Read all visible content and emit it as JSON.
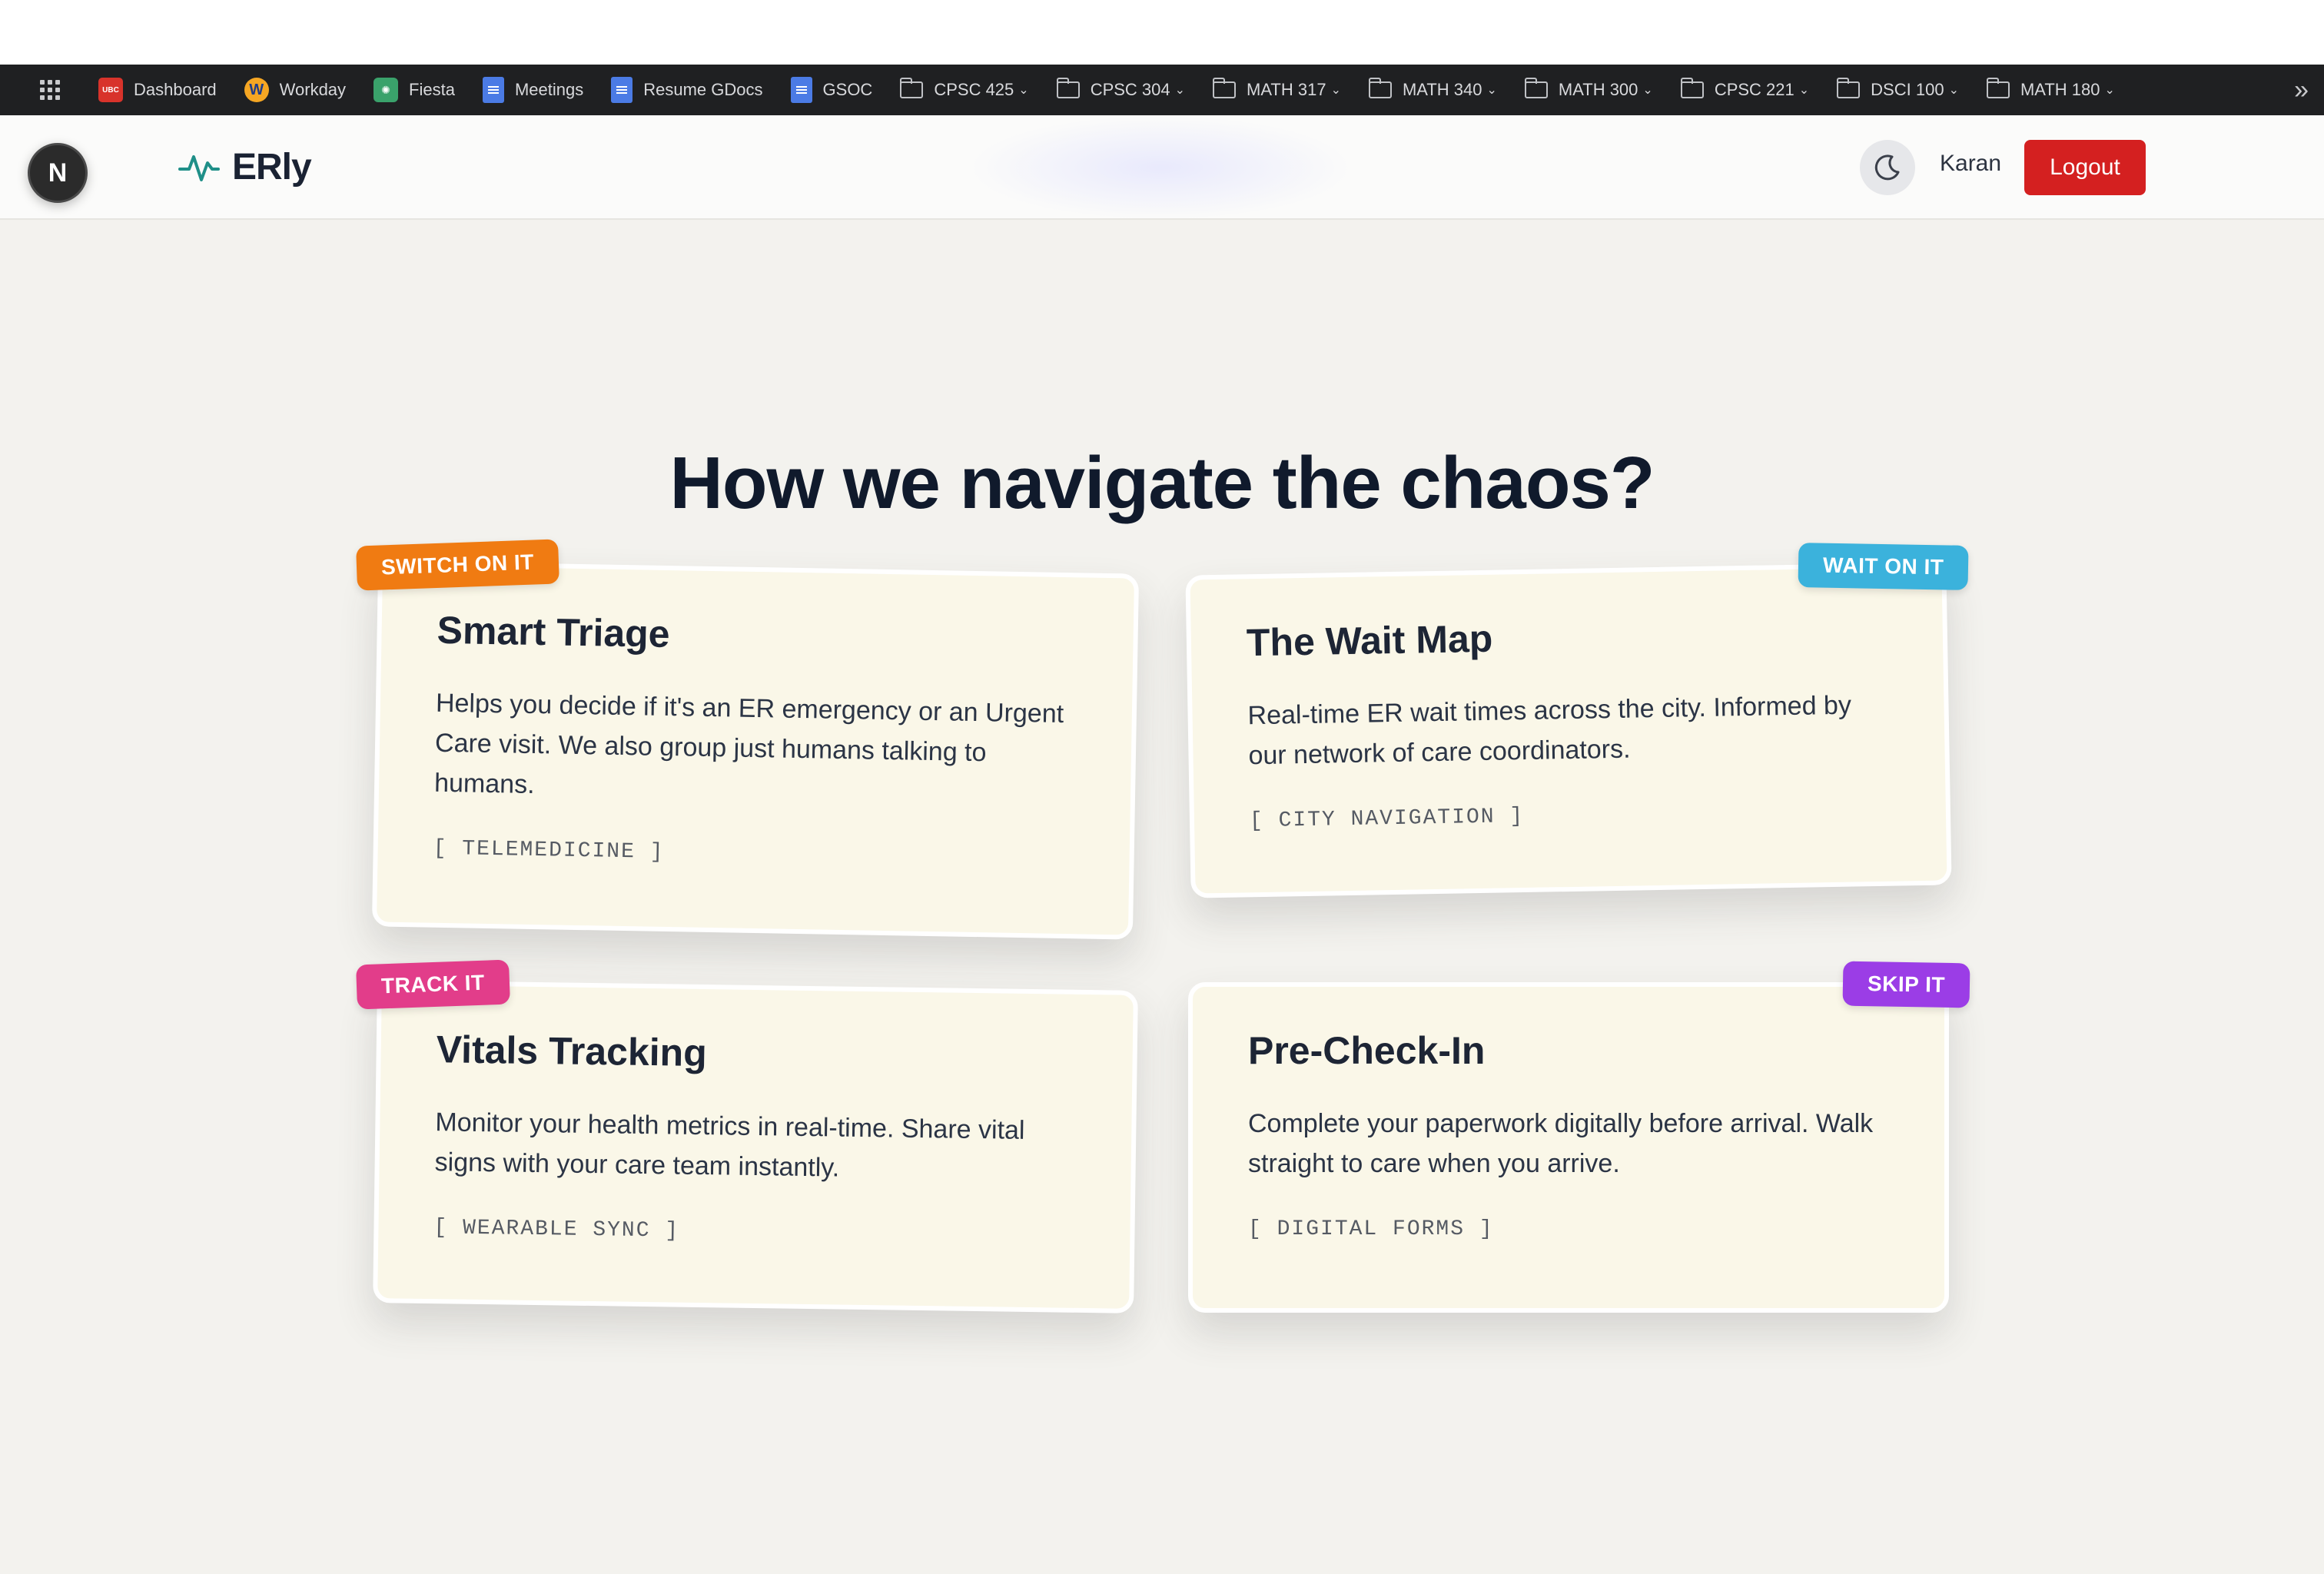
{
  "bookmarks": [
    {
      "label": "Dashboard",
      "icon": "ubc-icon",
      "type": "site"
    },
    {
      "label": "Workday",
      "icon": "workday-icon",
      "type": "site"
    },
    {
      "label": "Fiesta",
      "icon": "fiesta-icon",
      "type": "site"
    },
    {
      "label": "Meetings",
      "icon": "doc-icon",
      "type": "doc"
    },
    {
      "label": "Resume GDocs",
      "icon": "doc-icon",
      "type": "doc"
    },
    {
      "label": "GSOC",
      "icon": "doc-icon",
      "type": "doc"
    },
    {
      "label": "CPSC 425",
      "icon": "folder-icon",
      "type": "folder"
    },
    {
      "label": "CPSC 304",
      "icon": "folder-icon",
      "type": "folder"
    },
    {
      "label": "MATH 317",
      "icon": "folder-icon",
      "type": "folder"
    },
    {
      "label": "MATH 340",
      "icon": "folder-icon",
      "type": "folder"
    },
    {
      "label": "MATH 300",
      "icon": "folder-icon",
      "type": "folder"
    },
    {
      "label": "CPSC 221",
      "icon": "folder-icon",
      "type": "folder"
    },
    {
      "label": "DSCI 100",
      "icon": "folder-icon",
      "type": "folder"
    },
    {
      "label": "MATH 180",
      "icon": "folder-icon",
      "type": "folder"
    }
  ],
  "bookmarks_more": "»",
  "header": {
    "nx_badge": "N",
    "brand": "ERly",
    "user": "Karan",
    "logout_label": "Logout"
  },
  "section": {
    "heading": "How we navigate the chaos?"
  },
  "cards": [
    {
      "badge": "SWITCH ON IT",
      "badge_color": "#f07b12",
      "title": "Smart Triage",
      "desc": "Helps you decide if it's an ER emergency or an Urgent Care visit. We also group just humans talking to humans.",
      "tag": "[ TELEMEDICINE ]"
    },
    {
      "badge": "WAIT ON IT",
      "badge_color": "#3bb2dc",
      "title": "The Wait Map",
      "desc": "Real-time ER wait times across the city. Informed by our network of care coordinators.",
      "tag": "[ CITY NAVIGATION ]"
    },
    {
      "badge": "TRACK IT",
      "badge_color": "#e23d8a",
      "title": "Vitals Tracking",
      "desc": "Monitor your health metrics in real-time. Share vital signs with your care team instantly.",
      "tag": "[ WEARABLE SYNC ]"
    },
    {
      "badge": "SKIP IT",
      "badge_color": "#9b3de6",
      "title": "Pre-Check-In",
      "desc": "Complete your paperwork digitally before arrival. Walk straight to care when you arrive.",
      "tag": "[ DIGITAL FORMS ]"
    }
  ],
  "colors": {
    "logout": "#d42020",
    "brand_pulse": "#1f8f88",
    "card_bg": "#faf7e8",
    "page_bg": "#f3f2ee"
  }
}
